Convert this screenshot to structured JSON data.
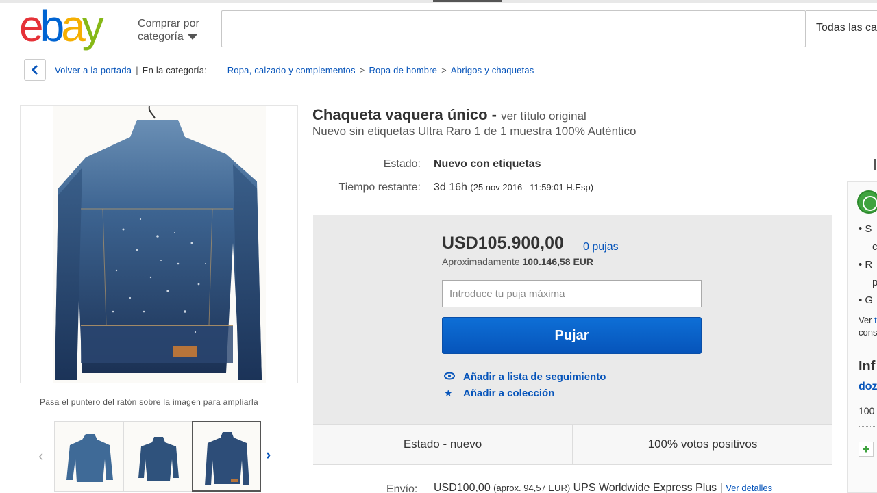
{
  "header": {
    "logo_letters": [
      "e",
      "b",
      "a",
      "y"
    ],
    "shop_by_line1": "Comprar por",
    "shop_by_line2": "categoría",
    "search_value": "",
    "category_select": "Todas las categorías"
  },
  "breadcrumb": {
    "back_label": "Volver a la portada",
    "category_label": "En la categoría:",
    "items": [
      "Ropa, calzado y complementos",
      "Ropa de hombre",
      "Abrigos y chaquetas"
    ]
  },
  "gallery": {
    "hover_hint": "Pasa el puntero del ratón sobre la imagen para ampliarla",
    "thumbnail_count": 3,
    "active_thumbnail": 3
  },
  "item": {
    "title": "Chaqueta vaquera único -",
    "original_title_link": "ver título original",
    "subtitle": "Nuevo sin etiquetas Ultra Raro 1 de 1 muestra 100% Auténtico",
    "condition_label": "Estado:",
    "condition_value": "Nuevo con etiquetas",
    "time_label": "Tiempo restante:",
    "time_value": "3d 16h",
    "time_end": "(25 nov 2016   11:59:01 H.Esp)"
  },
  "bid": {
    "price": "USD105.900,00",
    "bid_count": "0 pujas",
    "approx_label": "Aproximadamente",
    "approx_value": "100.146,58 EUR",
    "input_placeholder": "Introduce tu puja máxima",
    "bid_button": "Pujar",
    "watch_link": "Añadir a lista de seguimiento",
    "collection_link": "Añadir a colección"
  },
  "stats": {
    "left": "Estado - nuevo",
    "right": "100% votos positivos"
  },
  "shipping": {
    "label": "Envío:",
    "price": "USD100,00",
    "approx": "(aprox. 94,57 EUR)",
    "service": "UPS Worldwide Express Plus |",
    "details_link": "Ver detalles"
  },
  "sidebar": {
    "bullets": [
      "S",
      "c",
      "R",
      "p",
      "G"
    ],
    "see_line1_prefix": "Ver",
    "see_line1_link": "t",
    "see_line2": "cons",
    "info_heading": "Inf",
    "seller_name": "doz",
    "feedback": "100",
    "plus": "+"
  },
  "colors": {
    "ebay_red": "#e53238",
    "ebay_blue": "#0064d2",
    "ebay_yellow": "#f5af02",
    "ebay_green": "#86b817",
    "link_blue": "#0654ba",
    "bid_box_bg": "#eaeaea"
  }
}
